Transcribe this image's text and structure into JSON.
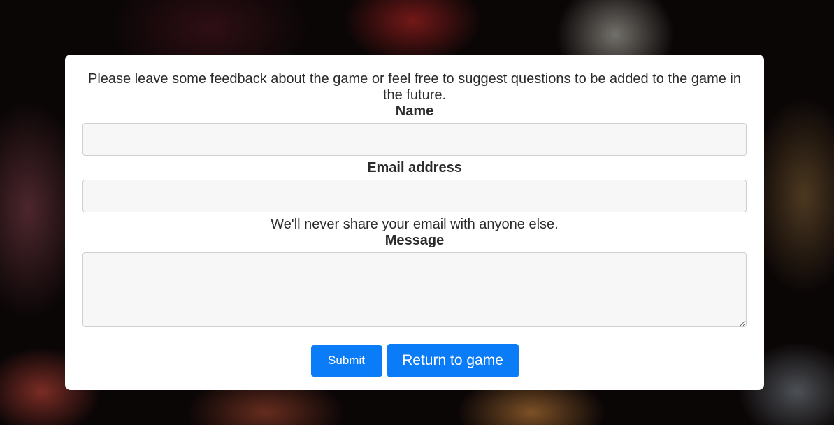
{
  "feedback_form": {
    "intro": "Please leave some feedback about the game or feel free to suggest questions to be added to the game in the future.",
    "name_label": "Name",
    "name_value": "",
    "email_label": "Email address",
    "email_value": "",
    "email_help": "We'll never share your email with anyone else.",
    "message_label": "Message",
    "message_value": "",
    "submit_label": "Submit",
    "return_label": "Return to game"
  },
  "colors": {
    "button_primary": "#0a7cf8",
    "card_background": "#ffffff",
    "input_background": "#f7f7f7"
  },
  "background": {
    "icon": "fantasy-game-artwork"
  }
}
